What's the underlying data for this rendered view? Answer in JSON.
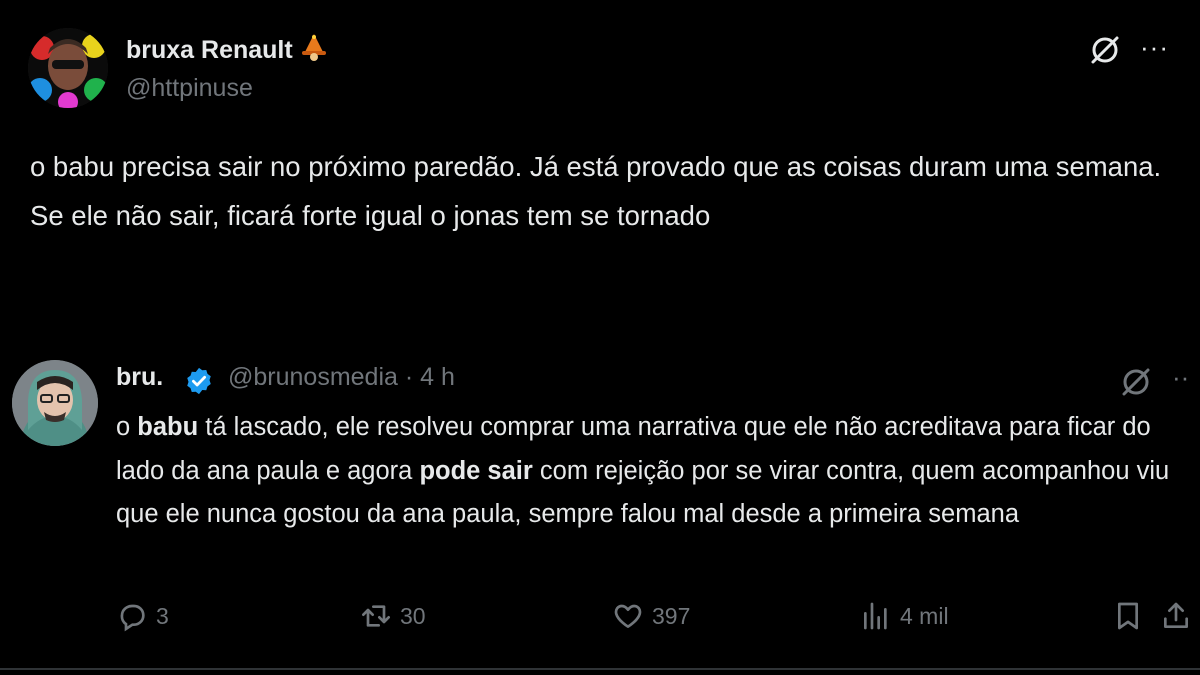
{
  "main_post": {
    "author_name": "bruxa Renault",
    "author_emoji": "witch-emoji",
    "author_handle": "@httpinuse",
    "text": "o babu precisa sair no próximo paredão. Já está provado que as coisas duram uma semana. Se ele não sair, ficará forte igual o jonas tem se tornado"
  },
  "quoted_post": {
    "author_name": "bru.",
    "verified": true,
    "handle_time": "@brunosmedia · 4 h",
    "text_parts": {
      "p1": "o ",
      "b1": "babu",
      "p2": " tá lascado, ele resolveu comprar uma narrativa que ele não acreditava para ficar do lado da ana paula e agora ",
      "b2": "pode sair",
      "p3": " com rejeição por se virar contra, quem acompanhou viu que ele nunca gostou da ana paula, sempre falou mal desde a primeira semana"
    }
  },
  "actions": {
    "replies": "3",
    "reposts": "30",
    "likes": "397",
    "views": "4 mil"
  },
  "colors": {
    "background": "#000000",
    "text": "#e7e9ea",
    "secondary": "#71767b",
    "verified": "#1d9bf0"
  }
}
